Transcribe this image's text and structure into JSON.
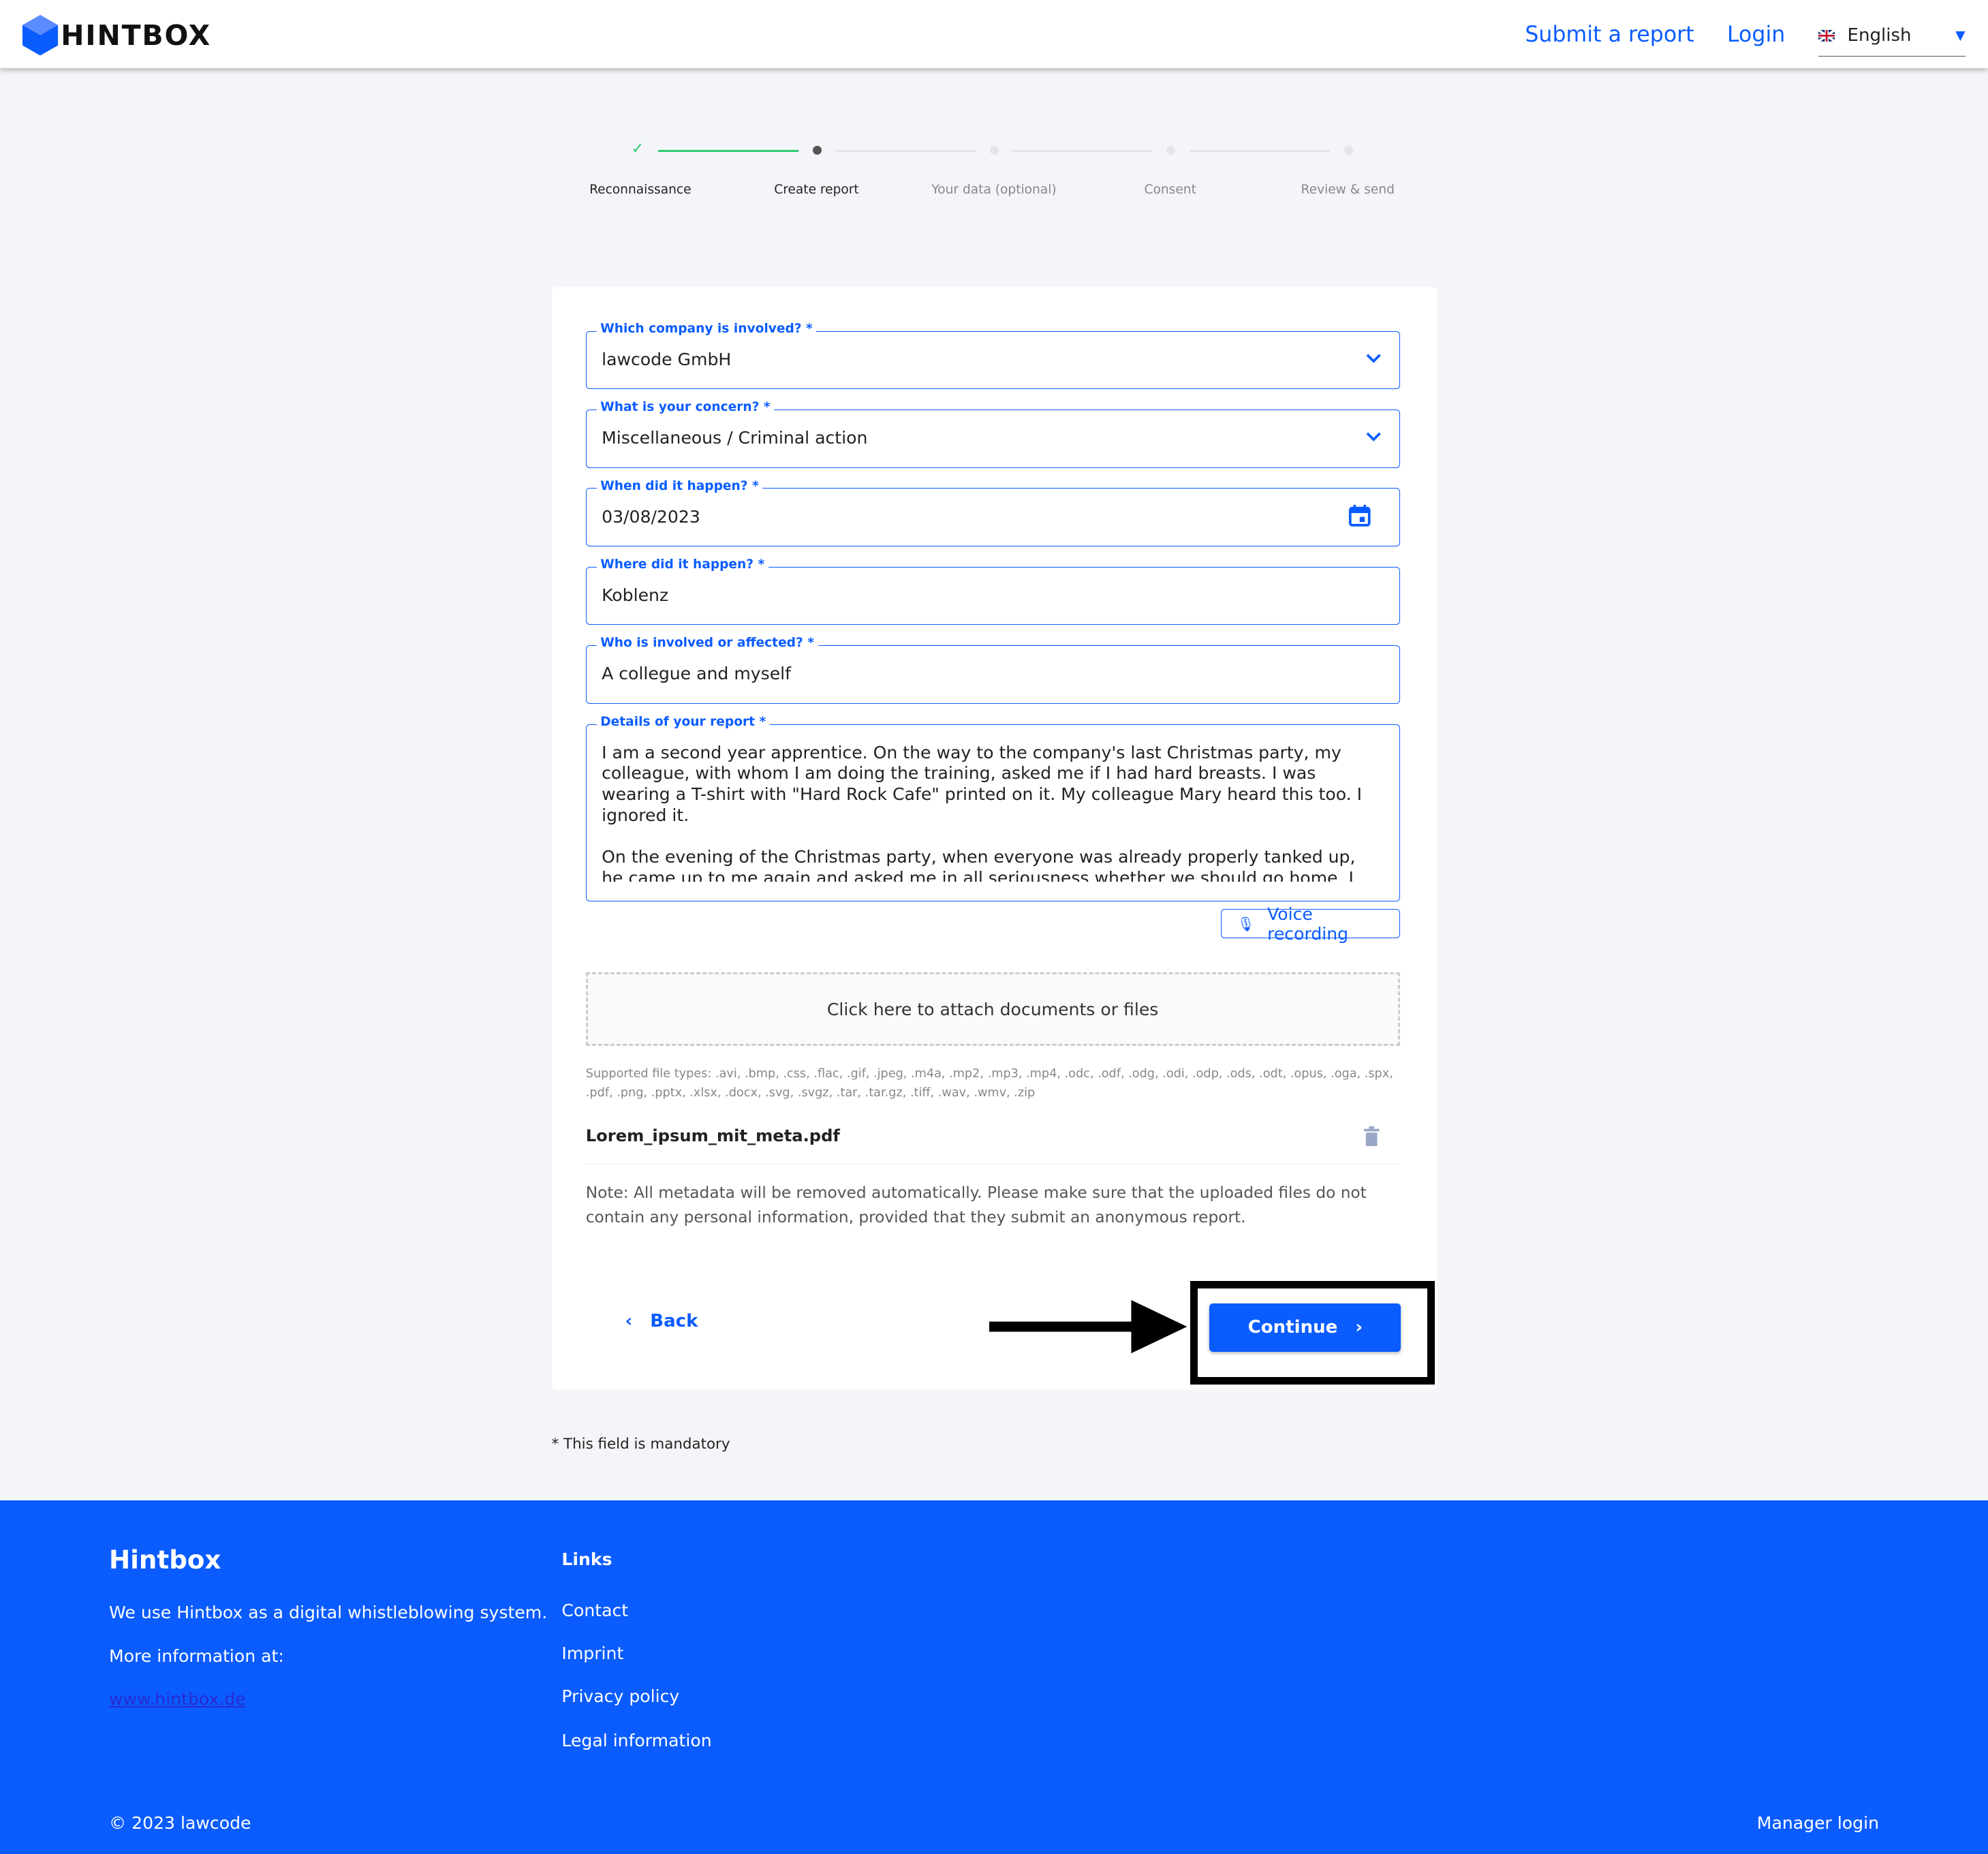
{
  "header": {
    "brand": "HINTBOX",
    "nav": [
      "Submit a report",
      "Login"
    ],
    "language": "English"
  },
  "steps": [
    {
      "label": "Reconnaissance",
      "state": "done"
    },
    {
      "label": "Create report",
      "state": "current"
    },
    {
      "label": "Your data (optional)",
      "state": "todo"
    },
    {
      "label": "Consent",
      "state": "todo"
    },
    {
      "label": "Review & send",
      "state": "todo"
    }
  ],
  "form": {
    "company": {
      "label": "Which company is involved? *",
      "value": "lawcode GmbH"
    },
    "concern": {
      "label": "What is your concern? *",
      "value": "Miscellaneous / Criminal action"
    },
    "date": {
      "label": "When did it happen? *",
      "value": "03/08/2023"
    },
    "place": {
      "label": "Where did it happen? *",
      "value": "Koblenz"
    },
    "involved": {
      "label": "Who is involved or affected? *",
      "value": "A collegue and myself"
    },
    "details": {
      "label": "Details of your report *",
      "value": "I am a second year apprentice. On the way to the company's last Christmas party, my colleague, with whom I am doing the training, asked me if I had hard breasts. I was wearing a T-shirt with \"Hard Rock Cafe\" printed on it. My colleague Mary heard this too. I ignored it.\n\nOn the evening of the Christmas party, when everyone was already properly tanked up, he came up to me again and asked me in all seriousness whether we should go home. I denied this. He grabbed my arm. I pushed him away and immediately went home."
    },
    "voice_label": "Voice recording",
    "attach_label": "Click here to attach documents or files",
    "file_types": "Supported file types: .avi, .bmp, .css, .flac, .gif, .jpeg, .m4a, .mp2, .mp3, .mp4, .odc, .odf, .odg, .odi, .odp, .ods, .odt, .opus, .oga, .spx, .pdf, .png, .pptx, .xlsx, .docx, .svg, .svgz, .tar, .tar.gz, .tiff, .wav, .wmv, .zip",
    "file_name": "Lorem_ipsum_mit_meta.pdf",
    "note": "Note: All metadata will be removed automatically. Please make sure that the uploaded files do not contain any personal information, provided that they submit an anonymous report.",
    "back": "Back",
    "continue": "Continue"
  },
  "mandatory": "* This field is mandatory",
  "footer": {
    "title": "Hintbox",
    "text1": "We use Hintbox as a digital whistleblowing system.",
    "text2": "More information at:",
    "link": "www.hintbox.de",
    "links_title": "Links",
    "links": [
      "Contact",
      "Imprint",
      "Privacy policy",
      "Legal information"
    ],
    "copyright": "© 2023 lawcode",
    "manager": "Manager login"
  },
  "colors": {
    "accent": "#0a5cff",
    "success": "#2ecc71"
  }
}
